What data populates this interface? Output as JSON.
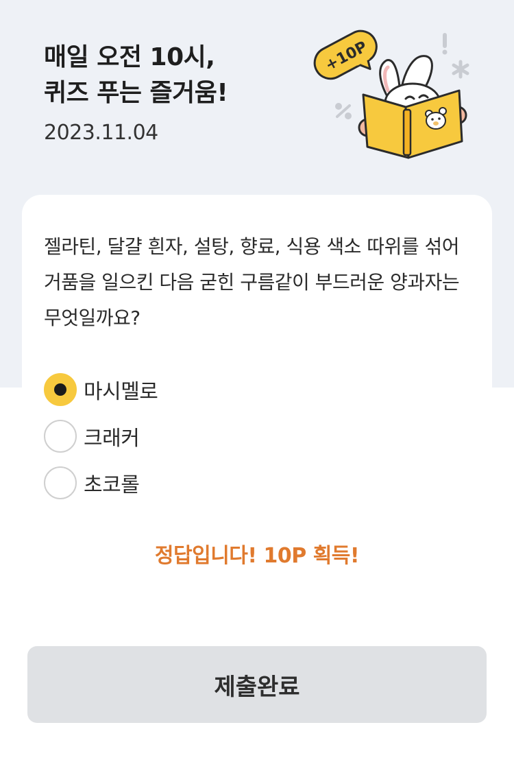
{
  "header": {
    "title_line1": "매일 오전 10시,",
    "title_line2": "퀴즈 푸는 즐거움!",
    "date": "2023.11.04",
    "badge": "+10P"
  },
  "quiz": {
    "question": "젤라틴, 달걀 흰자, 설탕, 향료, 식용 색소 따위를 섞어 거품을 일으킨 다음 굳힌 구름같이 부드러운 양과자는 무엇일까요?",
    "options": [
      {
        "label": "마시멜로",
        "selected": true
      },
      {
        "label": "크래커",
        "selected": false
      },
      {
        "label": "초코롤",
        "selected": false
      }
    ],
    "result_message": "정답입니다! 10P 획득!"
  },
  "submit": {
    "label": "제출완료"
  },
  "colors": {
    "accent_yellow": "#f7c93e",
    "result_orange": "#e07a2e",
    "top_background": "#eef1f6",
    "button_gray": "#dfe1e4"
  },
  "icons": [
    "rabbit-reading-book-illustration",
    "points-badge-icon"
  ]
}
